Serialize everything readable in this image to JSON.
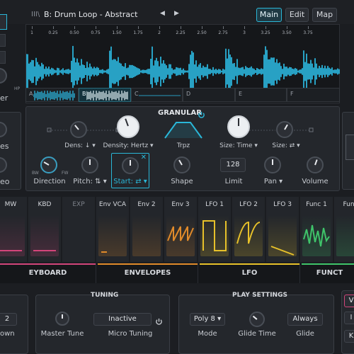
{
  "header": {
    "preset_icon": "III\\",
    "preset_title": "B:  Drum Loop - Abstract",
    "prev_label": "◀",
    "next_label": "▶",
    "tabs": [
      {
        "label": "Main",
        "active": true
      },
      {
        "label": "Edit",
        "active": false
      },
      {
        "label": "Map",
        "active": false
      }
    ]
  },
  "left_edge": {
    "fragment_er": "er",
    "fragment_hp": "HP",
    "fragment_es": "es",
    "fragment_eo": "eo"
  },
  "waveform": {
    "ruler_labels": [
      "1",
      "0.25",
      "0.50",
      "0.75",
      "1.50",
      "1.75",
      "2",
      "2.25",
      "2.50",
      "2.75",
      "3",
      "3.25",
      "3.50",
      "3.75"
    ],
    "slices": [
      {
        "label": "A",
        "active": false
      },
      {
        "label": "B",
        "active": true
      },
      {
        "label": "C",
        "active": false
      },
      {
        "label": "D",
        "active": false
      },
      {
        "label": "E",
        "active": false
      },
      {
        "label": "F",
        "active": false
      }
    ],
    "color": "#2ec4ef"
  },
  "granular": {
    "title": "GRANULAR",
    "power_icon": "power-icon",
    "controls": {
      "dens": "Dens: ↓ ▾",
      "density": "Density: Hertz ▾",
      "trpz": "Trpz",
      "size_time": "Size: Time ▾",
      "size": "Size: ⇄ ▾",
      "direction": "Direction",
      "bw": "BW",
      "fw": "FW",
      "pitch": "Pitch: ⇅ ▾",
      "start": "Start: ⇄ ▾",
      "shape": "Shape",
      "limit": "Limit",
      "limit_value": "128",
      "pan": "Pan ▾",
      "volume": "Volume"
    }
  },
  "mod_sources": [
    {
      "label": "MW",
      "color": "#d2457a"
    },
    {
      "label": "KBD",
      "color": "#d2457a"
    },
    {
      "label": "EXP",
      "color": "#555a62"
    },
    {
      "label": "Env VCA",
      "color": "#e08a2a"
    },
    {
      "label": "Env 2",
      "color": "#e08a2a"
    },
    {
      "label": "Env 3",
      "color": "#e08a2a"
    },
    {
      "label": "LFO 1",
      "color": "#e7c12a"
    },
    {
      "label": "LFO 2",
      "color": "#e7c12a"
    },
    {
      "label": "LFO 3",
      "color": "#e7c12a"
    },
    {
      "label": "Func 1",
      "color": "#3fc46a"
    },
    {
      "label": "Func",
      "color": "#3fc46a"
    }
  ],
  "section_tabs": [
    {
      "label": "EYBOARD",
      "color": "#d2457a"
    },
    {
      "label": "ENVELOPES",
      "color": "#e08a2a"
    },
    {
      "label": "LFO",
      "color": "#e7c12a"
    },
    {
      "label": "FUNCT",
      "color": "#3fc46a"
    }
  ],
  "tuning": {
    "title": "TUNING",
    "master_tune": "Master Tune",
    "micro_tuning": "Micro Tuning",
    "micro_value": "Inactive"
  },
  "play_settings": {
    "title": "PLAY SETTINGS",
    "mode": "Mode",
    "mode_value": "Poly 8 ▾",
    "glide_time": "Glide Time",
    "glide": "Glide",
    "glide_value": "Always"
  },
  "left_bottom": {
    "value": "2",
    "label": "own"
  },
  "right_bottom": {
    "btn1": "V",
    "btn2": "I",
    "btn3": "K"
  }
}
